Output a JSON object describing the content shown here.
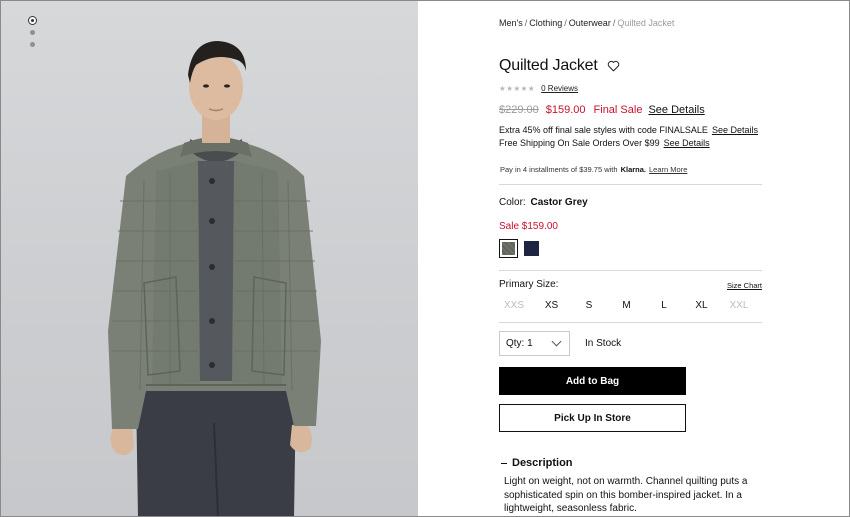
{
  "breadcrumb": {
    "items": [
      "Men's",
      "Clothing",
      "Outerwear"
    ],
    "current": "Quilted Jacket",
    "separator": "/"
  },
  "product": {
    "title": "Quilted Jacket",
    "rating_stars": "★★★★★",
    "reviews_label": "0 Reviews",
    "original_price": "$229.00",
    "sale_price": "$159.00",
    "final_sale_label": "Final Sale",
    "see_details_label": "See Details"
  },
  "promos": {
    "line1_text": "Extra 45% off final sale styles with code FINALSALE",
    "line1_link": "See Details",
    "line2_text": "Free Shipping On Sale Orders Over $99",
    "line2_link": "See Details"
  },
  "klarna": {
    "text": "Pay in 4 installments of $39.75 with",
    "brand": "Klarna.",
    "link": "Learn More"
  },
  "color": {
    "label": "Color:",
    "selected_name": "Castor Grey",
    "sale_text": "Sale $159.00",
    "swatches": [
      {
        "name": "Castor Grey",
        "hex": "#6e7268",
        "selected": true
      },
      {
        "name": "Navy",
        "hex": "#1d2540",
        "selected": false
      }
    ]
  },
  "size": {
    "label": "Primary Size:",
    "chart_link": "Size Chart",
    "options": [
      {
        "label": "XXS",
        "available": false
      },
      {
        "label": "XS",
        "available": true
      },
      {
        "label": "S",
        "available": true
      },
      {
        "label": "M",
        "available": true
      },
      {
        "label": "L",
        "available": true
      },
      {
        "label": "XL",
        "available": true
      },
      {
        "label": "XXL",
        "available": false
      }
    ]
  },
  "purchase": {
    "qty_label": "Qty: 1",
    "stock_status": "In Stock",
    "add_to_bag": "Add to Bag",
    "pick_up": "Pick Up In Store"
  },
  "description": {
    "heading": "Description",
    "body": "Light on weight, not on warmth. Channel quilting puts a sophisticated spin on this bomber-inspired jacket. In a lightweight, seasonless fabric."
  },
  "gallery": {
    "image_count": 3,
    "active_index": 0
  },
  "colors": {
    "sale_red": "#c8102e",
    "jacket_green": "#7a8075",
    "button_black": "#000000"
  }
}
